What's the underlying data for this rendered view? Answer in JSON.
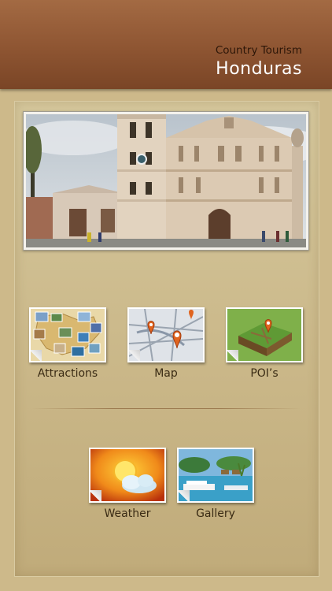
{
  "header": {
    "subtitle": "Country Tourism",
    "title": "Honduras"
  },
  "menu": {
    "attractions": "Attractions",
    "map": "Map",
    "pois": "POI’s",
    "weather": "Weather",
    "gallery": "Gallery"
  },
  "colors": {
    "header": "#8e5532",
    "background": "#cdb98a",
    "label": "#3a2b14"
  }
}
